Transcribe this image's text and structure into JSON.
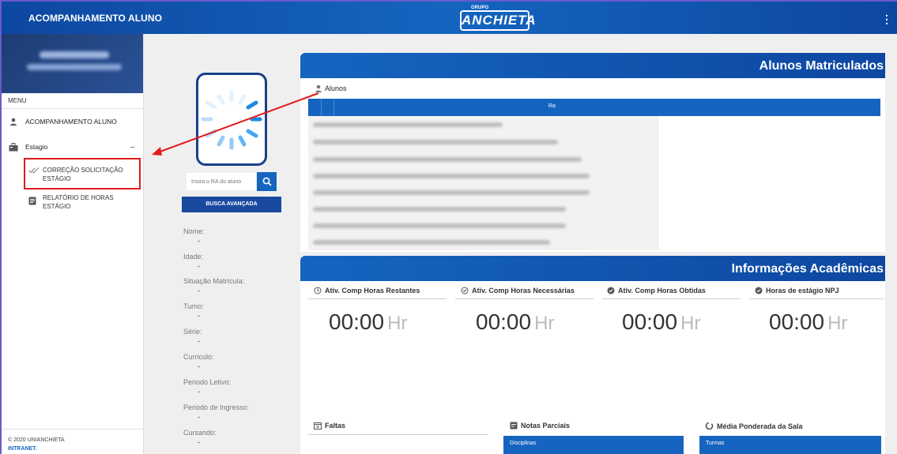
{
  "header": {
    "app_title": "ACOMPANHAMENTO ALUNO",
    "logo_small": "GRUPO",
    "logo_name": "ANCHIETA",
    "menu_icon": "kebab-menu-icon"
  },
  "sidebar": {
    "menu_label": "MENU",
    "items": [
      {
        "label": "ACOMPANHAMENTO ALUNO",
        "icon": "person-icon"
      },
      {
        "label": "Estagio",
        "icon": "briefcase-icon"
      }
    ],
    "collapse_symbol": "–",
    "sub_items": [
      {
        "label": "CORREÇÃO SOLICITAÇÃO ESTÁGIO",
        "icon": "double-check-icon"
      },
      {
        "label": "RELATÓRIO DE HORAS ESTÁGIO",
        "icon": "document-icon"
      }
    ],
    "footer_copyright": "© 2020 UNIANCHIETA",
    "footer_link": "INTRANET."
  },
  "student": {
    "search_placeholder": "Insira o RA do aluno",
    "advanced_search_label": "BUSCA AVANÇADA",
    "fields": [
      {
        "label": "Nome:",
        "value": "-"
      },
      {
        "label": "Idade:",
        "value": "-"
      },
      {
        "label": "Situação Matrícula:",
        "value": "-"
      },
      {
        "label": "Turno:",
        "value": "-"
      },
      {
        "label": "Série:",
        "value": "-"
      },
      {
        "label": "Curriculo:",
        "value": "-"
      },
      {
        "label": "Periodo Letivo:",
        "value": "-"
      },
      {
        "label": "Periodo de Ingresso:",
        "value": "-"
      },
      {
        "label": "Cursando:",
        "value": "-"
      }
    ]
  },
  "enrolled": {
    "title": "Alunos Matriculados",
    "section_label": "Alunos",
    "column_ra": "Ra"
  },
  "academic": {
    "title": "Informações Acadêmicas",
    "indicators": [
      {
        "label": "Ativ. Comp Horas Restantes",
        "value": "00:00",
        "unit": "Hr"
      },
      {
        "label": "Ativ. Comp Horas Necessárias",
        "value": "00:00",
        "unit": "Hr"
      },
      {
        "label": "Ativ. Comp Horas Obtidas",
        "value": "00:00",
        "unit": "Hr"
      },
      {
        "label": "Horas de estágio NPJ",
        "value": "00:00",
        "unit": "Hr"
      }
    ],
    "faltas_label": "Faltas",
    "notas_label": "Notas Parciais",
    "notas_column": "Disciplinas",
    "media_label": "Média Ponderada da Sala",
    "media_column": "Turmas"
  },
  "colors": {
    "primary": "#1565c0",
    "header_dark": "#0d47a1",
    "highlight": "#e01b1b"
  }
}
